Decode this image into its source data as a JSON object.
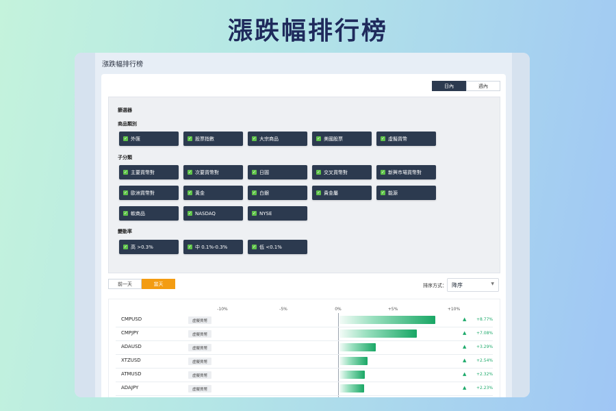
{
  "hero_title": "漲跌幅排行榜",
  "window_title": "漲跌幅排行榜",
  "period": {
    "options": [
      "日內",
      "週內"
    ],
    "selected": "日內"
  },
  "filters": {
    "title": "篩選器",
    "product_category": {
      "label": "商品類別",
      "items": [
        "外匯",
        "股票指數",
        "大宗商品",
        "美國股票",
        "虛擬貨幣"
      ]
    },
    "sub_category": {
      "label": "子分類",
      "items": [
        "主要貨幣對",
        "次要貨幣對",
        "日圓",
        "交叉貨幣對",
        "新興市場貨幣對",
        "歐洲貨幣對",
        "黃金",
        "白銀",
        "貴金屬",
        "能源",
        "軟商品",
        "NASDAQ",
        "NYSE"
      ]
    },
    "volatility": {
      "label": "變動率",
      "items": [
        "高 >0.3%",
        "中 0.1%-0.3%",
        "低 <0.1%"
      ]
    }
  },
  "day_toggle": {
    "options": [
      "前一天",
      "當天"
    ],
    "selected": "當天"
  },
  "sort": {
    "label": "排序方式：",
    "value": "降序"
  },
  "axis_labels": [
    "-10%",
    "-5%",
    "0%",
    "+5%",
    "+10%"
  ],
  "rows": [
    {
      "symbol": "CMPUSD",
      "category": "虛擬貨幣",
      "change_pct": 8.77,
      "change_text": "+8.77%"
    },
    {
      "symbol": "CMPJPY",
      "category": "虛擬貨幣",
      "change_pct": 7.08,
      "change_text": "+7.08%"
    },
    {
      "symbol": "ADAUSD",
      "category": "虛擬貨幣",
      "change_pct": 3.29,
      "change_text": "+3.29%"
    },
    {
      "symbol": "XTZUSD",
      "category": "虛擬貨幣",
      "change_pct": 2.54,
      "change_text": "+2.54%"
    },
    {
      "symbol": "ATMUSD",
      "category": "虛擬貨幣",
      "change_pct": 2.32,
      "change_text": "+2.32%"
    },
    {
      "symbol": "ADAJPY",
      "category": "虛擬貨幣",
      "change_pct": 2.23,
      "change_text": "+2.23%"
    }
  ],
  "colors": {
    "chip": "#2c3a4f",
    "accent": "#f39c12",
    "positive": "#1eaa6b"
  }
}
